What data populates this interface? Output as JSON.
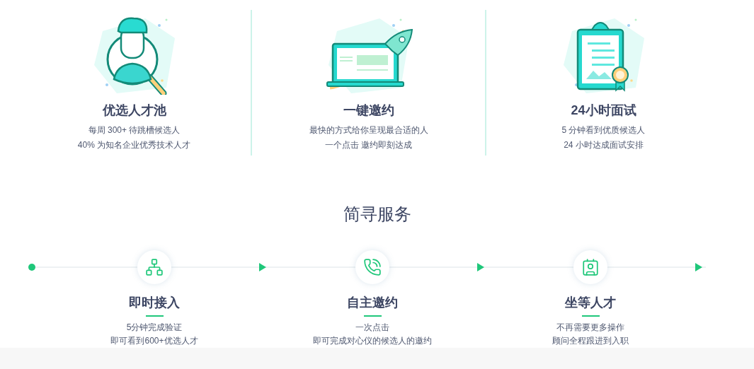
{
  "features": [
    {
      "title": "优选人才池",
      "lines": [
        "每周 300+ 待跳槽候选人",
        "40% 为知名企业优秀技术人才"
      ]
    },
    {
      "title": "一键邀约",
      "lines": [
        "最快的方式给你呈现最合适的人",
        "一个点击 邀约即刻达成"
      ]
    },
    {
      "title": "24小时面试",
      "lines": [
        "5 分钟看到优质候选人",
        "24 小时达成面试安排"
      ]
    }
  ],
  "services": {
    "title": "简寻服务",
    "steps": [
      {
        "title": "即时接入",
        "lines": [
          "5分钟完成验证",
          "即可看到600+优选人才"
        ]
      },
      {
        "title": "自主邀约",
        "lines": [
          "一次点击",
          "即可完成对心仪的候选人的邀约"
        ]
      },
      {
        "title": "坐等人才",
        "lines": [
          "不再需要更多操作",
          "顾问全程跟进到入职"
        ]
      }
    ]
  }
}
